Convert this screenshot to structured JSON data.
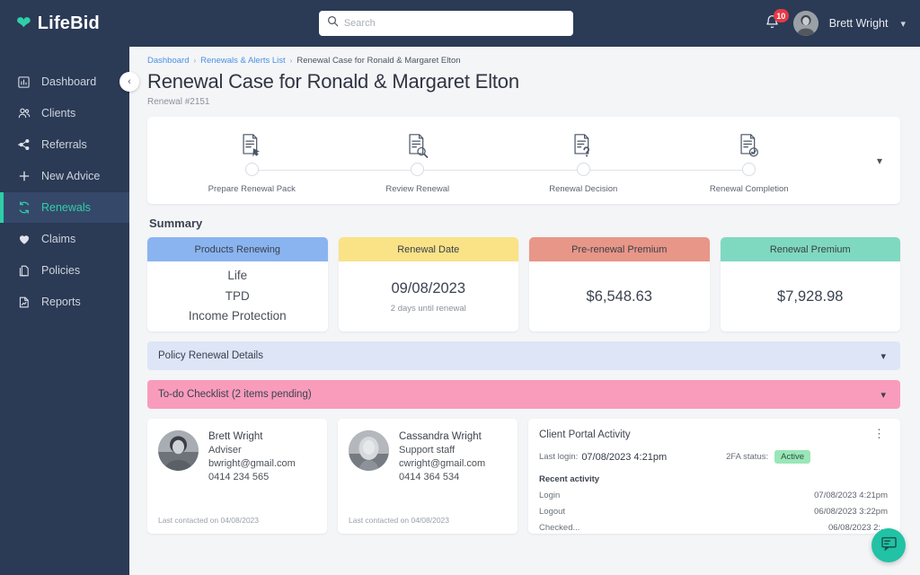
{
  "brand": {
    "name": "LifeBid",
    "heart_icon": "heart-icon",
    "accent": "#2ecfa8"
  },
  "topbar": {
    "search": {
      "placeholder": "Search",
      "value": "",
      "icon": "search-icon"
    },
    "notifications": {
      "icon": "bell-icon",
      "count": "10"
    },
    "user": {
      "name": "Brett Wright",
      "avatar": "user-avatar",
      "caret": "chevron-down-icon"
    }
  },
  "sidebar": {
    "collapse_icon": "chevron-left-icon",
    "items": [
      {
        "label": "Dashboard",
        "icon": "chart-bar-icon",
        "active": false
      },
      {
        "label": "Clients",
        "icon": "users-icon",
        "active": false
      },
      {
        "label": "Referrals",
        "icon": "share-network-icon",
        "active": false
      },
      {
        "label": "New Advice",
        "icon": "plus-icon",
        "active": false
      },
      {
        "label": "Renewals",
        "icon": "refresh-icon",
        "active": true
      },
      {
        "label": "Claims",
        "icon": "heart-icon",
        "active": false
      },
      {
        "label": "Policies",
        "icon": "copy-icon",
        "active": false
      },
      {
        "label": "Reports",
        "icon": "document-chart-icon",
        "active": false
      }
    ]
  },
  "breadcrumb": {
    "items": [
      "Dashboard",
      "Renewals & Alerts List"
    ],
    "current": "Renewal Case for Ronald & Margaret Elton",
    "separator": "›"
  },
  "page": {
    "title": "Renewal Case for Ronald & Margaret Elton",
    "subtitle": "Renewal #2151"
  },
  "stepper": {
    "expand_icon": "chevron-down-icon",
    "steps": [
      {
        "label": "Prepare Renewal Pack",
        "icon": "document-prepare-icon"
      },
      {
        "label": "Review Renewal",
        "icon": "document-search-icon"
      },
      {
        "label": "Renewal Decision",
        "icon": "document-question-icon"
      },
      {
        "label": "Renewal Completion",
        "icon": "document-check-icon"
      }
    ]
  },
  "summary": {
    "title": "Summary",
    "cards": [
      {
        "header": "Products Renewing",
        "header_color": "#8ab4f0",
        "type": "list",
        "items": [
          "Life",
          "TPD",
          "Income Protection"
        ]
      },
      {
        "header": "Renewal Date",
        "header_color": "#fae287",
        "type": "value",
        "value": "09/08/2023",
        "note": "2 days until renewal"
      },
      {
        "header": "Pre-renewal Premium",
        "header_color": "#e89687",
        "type": "value",
        "value": "$6,548.63",
        "note": ""
      },
      {
        "header": "Renewal Premium",
        "header_color": "#7fd9c0",
        "type": "value",
        "value": "$7,928.98",
        "note": ""
      }
    ]
  },
  "accordions": [
    {
      "label": "Policy Renewal Details",
      "count": "",
      "color": "#dde5f7",
      "chevron": "chevron-down-icon"
    },
    {
      "label": "To-do Checklist",
      "count": "(2 items pending)",
      "color": "#f99cbb",
      "chevron": "chevron-down-icon"
    }
  ],
  "contacts": [
    {
      "name": "Brett Wright",
      "role": "Adviser",
      "email": "bwright@gmail.com",
      "phone": "0414 234 565",
      "footer": "Last contacted on 04/08/2023",
      "avatar": "contact-avatar"
    },
    {
      "name": "Cassandra Wright",
      "role": "Support staff",
      "email": "cwright@gmail.com",
      "phone": "0414 364 534",
      "footer": "Last contacted on 04/08/2023",
      "avatar": "contact-avatar"
    }
  ],
  "portal": {
    "title": "Client Portal Activity",
    "menu_icon": "kebab-menu-icon",
    "last_login_label": "Last login:",
    "last_login_value": "07/08/2023 4:21pm",
    "twofa_label": "2FA status:",
    "twofa_status": "Active",
    "twofa_color": "#9ae6b8",
    "recent_title": "Recent activity",
    "activity": [
      {
        "action": "Login",
        "time": "07/08/2023 4:21pm"
      },
      {
        "action": "Logout",
        "time": "06/08/2023 3:22pm"
      },
      {
        "action": "Checked...",
        "time": "06/08/2023 2:..."
      }
    ]
  },
  "chat": {
    "icon": "chat-icon",
    "color": "#21c2a5"
  }
}
